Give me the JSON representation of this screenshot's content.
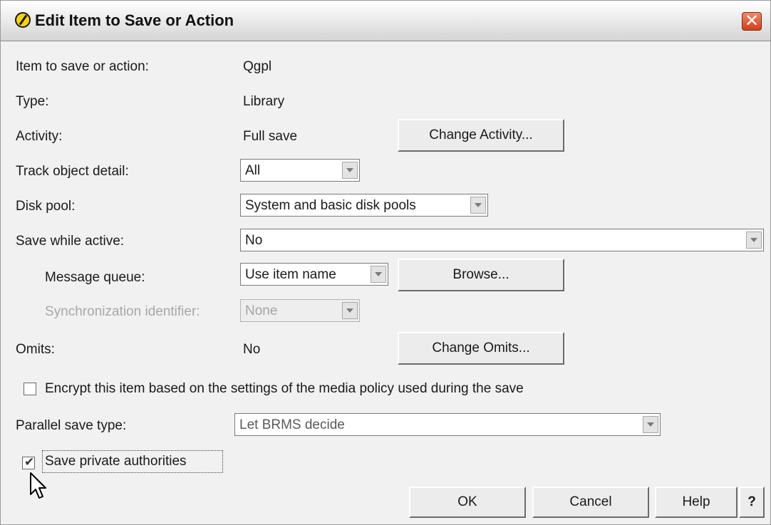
{
  "dialog": {
    "title": "Edit Item to Save or Action",
    "close_glyph": "✕"
  },
  "fields": {
    "item_label": "Item to save or action:",
    "item_value": "Qgpl",
    "type_label": "Type:",
    "type_value": "Library",
    "activity_label": "Activity:",
    "activity_value": "Full save",
    "change_activity_button": "Change Activity...",
    "track_label": "Track object detail:",
    "track_value": "All",
    "disk_pool_label": "Disk pool:",
    "disk_pool_value": "System and basic disk pools",
    "swa_label": "Save while active:",
    "swa_value": "No",
    "msgq_label": "Message queue:",
    "msgq_value": "Use item name",
    "browse_button": "Browse...",
    "sync_label": "Synchronization identifier:",
    "sync_value": "None",
    "omits_label": "Omits:",
    "omits_value": "No",
    "change_omits_button": "Change Omits...",
    "encrypt_label": "Encrypt this item based on the settings of the media policy used during the save",
    "encrypt_checked": false,
    "parallel_label": "Parallel save type:",
    "parallel_value": "Let BRMS decide",
    "save_private_label": "Save private authorities",
    "save_private_checked": true
  },
  "buttons": {
    "ok": "OK",
    "cancel": "Cancel",
    "help": "Help",
    "whats_this": "?"
  },
  "icons": {
    "title_icon": "edit-item-icon",
    "dropdown": "chevron-down-icon",
    "cursor": "mouse-pointer-icon"
  }
}
